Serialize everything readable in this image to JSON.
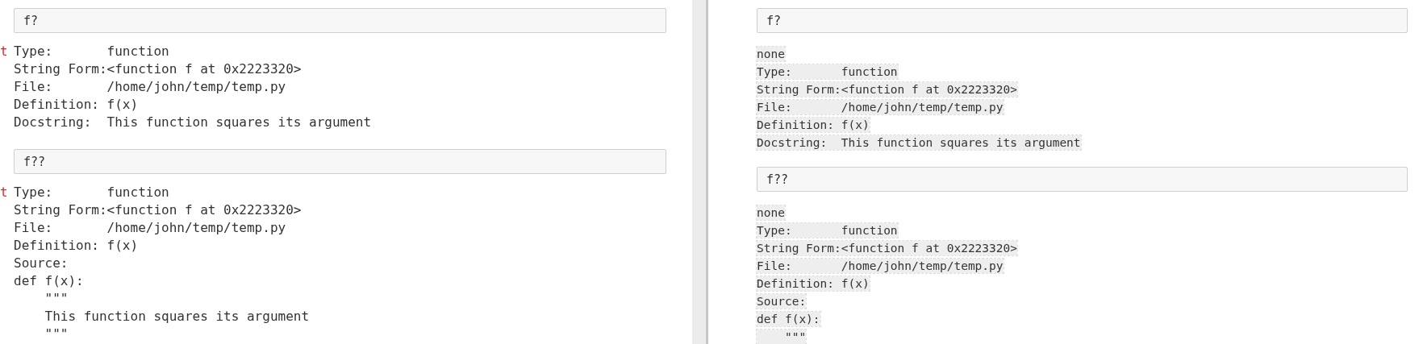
{
  "left_pane": {
    "cells": [
      {
        "input": "f?",
        "output_prompt": "t",
        "output_lines": [
          "Type:       function",
          "String Form:<function f at 0x2223320>",
          "File:       /home/john/temp/temp.py",
          "Definition: f(x)",
          "Docstring:  This function squares its argument"
        ]
      },
      {
        "input": "f??",
        "output_prompt": "t",
        "output_lines": [
          "Type:       function",
          "String Form:<function f at 0x2223320>",
          "File:       /home/john/temp/temp.py",
          "Definition: f(x)",
          "Source:",
          "def f(x):",
          "    \"\"\"",
          "    This function squares its argument",
          "    \"\"\""
        ]
      }
    ]
  },
  "right_pane": {
    "cells": [
      {
        "input": "f?",
        "output_lines": [
          "none",
          "Type:       function",
          "String Form:<function f at 0x2223320>",
          "File:       /home/john/temp/temp.py",
          "Definition: f(x)",
          "Docstring:  This function squares its argument"
        ]
      },
      {
        "input": "f??",
        "output_lines": [
          "none",
          "Type:       function",
          "String Form:<function f at 0x2223320>",
          "File:       /home/john/temp/temp.py",
          "Definition: f(x)",
          "Source:",
          "def f(x):",
          "    \"\"\""
        ]
      }
    ]
  }
}
